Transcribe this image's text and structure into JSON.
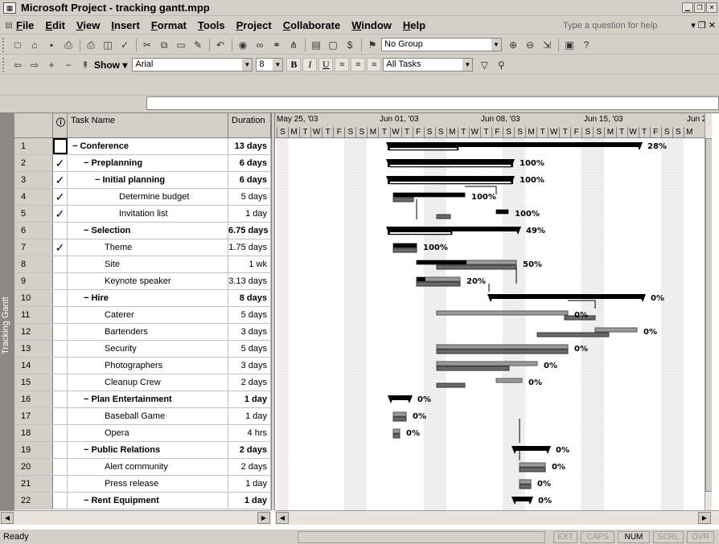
{
  "window": {
    "title": "Microsoft Project - tracking gantt.mpp"
  },
  "menu": [
    "File",
    "Edit",
    "View",
    "Insert",
    "Format",
    "Tools",
    "Project",
    "Collaborate",
    "Window",
    "Help"
  ],
  "help_placeholder": "Type a question for help",
  "toolbar": {
    "group_value": "No Group",
    "show_label": "Show",
    "font_value": "Arial",
    "size_value": "8",
    "filter_value": "All Tasks"
  },
  "view_bar_label": "Tracking Gantt",
  "columns": {
    "name": "Task Name",
    "duration": "Duration"
  },
  "timescale": {
    "weeks": [
      "May 25, '03",
      "Jun 01, '03",
      "Jun 08, '03",
      "Jun 15, '03",
      "Jun 2"
    ],
    "day_letters": [
      "S",
      "M",
      "T",
      "W",
      "T",
      "F",
      "S",
      "S",
      "M",
      "T",
      "W",
      "T",
      "F",
      "S",
      "S",
      "M",
      "T",
      "W",
      "T",
      "F",
      "S",
      "S",
      "M",
      "T",
      "W",
      "T",
      "F",
      "S",
      "S",
      "M",
      "T",
      "W",
      "T",
      "F",
      "S",
      "S",
      "M"
    ]
  },
  "tasks": [
    {
      "id": "1",
      "check": "",
      "name": "Conference",
      "duration": "13 days",
      "level": 0,
      "summary": true,
      "pct": "28%"
    },
    {
      "id": "2",
      "check": "✓",
      "name": "Preplanning",
      "duration": "6 days",
      "level": 1,
      "summary": true,
      "pct": "100%"
    },
    {
      "id": "3",
      "check": "✓",
      "name": "Initial planning",
      "duration": "6 days",
      "level": 2,
      "summary": true,
      "pct": "100%"
    },
    {
      "id": "4",
      "check": "✓",
      "name": "Determine budget",
      "duration": "5 days",
      "level": 3,
      "summary": false,
      "pct": "100%"
    },
    {
      "id": "5",
      "check": "✓",
      "name": "Invitation list",
      "duration": "1 day",
      "level": 3,
      "summary": false,
      "pct": "100%"
    },
    {
      "id": "6",
      "check": "",
      "name": "Selection",
      "duration": "6.75 days",
      "level": 1,
      "summary": true,
      "pct": "49%"
    },
    {
      "id": "7",
      "check": "✓",
      "name": "Theme",
      "duration": "1.75 days",
      "level": 2,
      "summary": false,
      "pct": "100%"
    },
    {
      "id": "8",
      "check": "",
      "name": "Site",
      "duration": "1 wk",
      "level": 2,
      "summary": false,
      "pct": "50%"
    },
    {
      "id": "9",
      "check": "",
      "name": "Keynote speaker",
      "duration": "3.13 days",
      "level": 2,
      "summary": false,
      "pct": "20%"
    },
    {
      "id": "10",
      "check": "",
      "name": "Hire",
      "duration": "8 days",
      "level": 1,
      "summary": true,
      "pct": "0%"
    },
    {
      "id": "11",
      "check": "",
      "name": "Caterer",
      "duration": "5 days",
      "level": 2,
      "summary": false,
      "pct": "0%"
    },
    {
      "id": "12",
      "check": "",
      "name": "Bartenders",
      "duration": "3 days",
      "level": 2,
      "summary": false,
      "pct": "0%"
    },
    {
      "id": "13",
      "check": "",
      "name": "Security",
      "duration": "5 days",
      "level": 2,
      "summary": false,
      "pct": "0%"
    },
    {
      "id": "14",
      "check": "",
      "name": "Photographers",
      "duration": "3 days",
      "level": 2,
      "summary": false,
      "pct": "0%"
    },
    {
      "id": "15",
      "check": "",
      "name": "Cleanup Crew",
      "duration": "2 days",
      "level": 2,
      "summary": false,
      "pct": "0%"
    },
    {
      "id": "16",
      "check": "",
      "name": "Plan Entertainment",
      "duration": "1 day",
      "level": 1,
      "summary": true,
      "pct": "0%"
    },
    {
      "id": "17",
      "check": "",
      "name": "Baseball Game",
      "duration": "1 day",
      "level": 2,
      "summary": false,
      "pct": "0%"
    },
    {
      "id": "18",
      "check": "",
      "name": "Opera",
      "duration": "4 hrs",
      "level": 2,
      "summary": false,
      "pct": "0%"
    },
    {
      "id": "19",
      "check": "",
      "name": "Public Relations",
      "duration": "2 days",
      "level": 1,
      "summary": true,
      "pct": "0%"
    },
    {
      "id": "20",
      "check": "",
      "name": "Alert community",
      "duration": "2 days",
      "level": 2,
      "summary": false,
      "pct": "0%"
    },
    {
      "id": "21",
      "check": "",
      "name": "Press release",
      "duration": "1 day",
      "level": 2,
      "summary": false,
      "pct": "0%"
    },
    {
      "id": "22",
      "check": "",
      "name": "Rent Equipment",
      "duration": "1 day",
      "level": 1,
      "summary": true,
      "pct": "0%"
    }
  ],
  "status": {
    "text": "Ready",
    "indicators": [
      {
        "label": "EXT",
        "on": false
      },
      {
        "label": "CAPS",
        "on": false
      },
      {
        "label": "NUM",
        "on": true
      },
      {
        "label": "SCRL",
        "on": false
      },
      {
        "label": "OVR",
        "on": false
      }
    ]
  }
}
